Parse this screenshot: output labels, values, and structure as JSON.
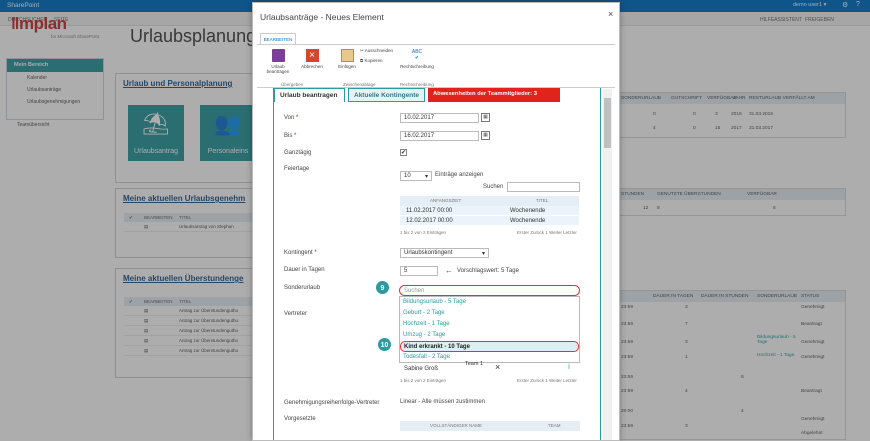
{
  "top": {
    "app": "SharePoint",
    "user": "demo user1 ▾"
  },
  "userbar": {
    "l1": "DURCHSUCHEN",
    "l2": "SEITE",
    "help": "HILFEASSISTENT",
    "share": "FREIGEBEN"
  },
  "logo": {
    "line1": "mplan",
    "line2": "for Microsoft SharePoint"
  },
  "page": {
    "title": "Urlaubsplanung H"
  },
  "nav": {
    "header": "Mein Bereich",
    "items": [
      "Kalender",
      "Urlaubsanträge",
      "Urlaubsgenehmigungen"
    ],
    "extra": "Teamübersicht"
  },
  "bg": {
    "card1": "Urlaub und Personalplanung",
    "tile1": "Urlaubsantrag",
    "tile2": "Personaleins",
    "card2": "Meine aktuellen Urlaubsgenehm",
    "card3": "Meine aktuellen Überstundenge",
    "grid_hdr": [
      "BEARBEITEN",
      "TITEL"
    ],
    "grid2_rows": [
      "Urlaubsantrag von Stephan"
    ],
    "grid3_rows": [
      "Antrag zur Überstundenguthu",
      "Antrag zur Überstundenguthu",
      "Antrag zur Überstundenguthu",
      "Antrag zur Überstundenguthu",
      "Antrag zur Überstundenguthu"
    ],
    "rt1_hdr": [
      "SONDERURLAUB",
      "GUTSCHRIFT",
      "VERFÜGBAR",
      "JAHR",
      "RESTURLAUB VERFÄLLT AM"
    ],
    "rt1_rows": [
      [
        "0",
        "0",
        "3",
        "2016",
        "31.03.2016"
      ],
      [
        "4",
        "0",
        "15",
        "2017",
        "31.03.2017"
      ]
    ],
    "rt2_hdr": [
      "STUNDEN",
      "GENUTZTE ÜBERSTUNDEN",
      "VERFÜGBAR"
    ],
    "rt2_row": [
      "12",
      "8",
      "6"
    ],
    "rt3_hdr": [
      "DAUER IN TAGEN",
      "DAUER IN STUNDEN",
      "SONDERURLAUB",
      "STATUS"
    ],
    "rt3_rows": [
      [
        "23:59",
        "3",
        "",
        "",
        "Genehmigt"
      ],
      [
        "23:59",
        "7",
        "",
        "",
        "Beantragt"
      ],
      [
        "23:59",
        "3",
        "",
        "Bildungsurlaub - 5 Tage",
        "Genehmigt"
      ],
      [
        "23:59",
        "1",
        "",
        "Hochzeit - 1 Tage",
        "Genehmigt"
      ],
      [
        "23:59",
        "",
        "8",
        "",
        ""
      ],
      [
        "23:59",
        "4",
        "",
        "",
        "Beantragt"
      ],
      [
        "20:00",
        "",
        "4",
        "",
        "Genehmigt"
      ],
      [
        "23:59",
        "3",
        "",
        "",
        "Abgelehnt"
      ]
    ]
  },
  "dialog": {
    "title": "Urlaubsanträge - Neues Element",
    "close": "×",
    "ribbon_tab": "BEARBEITEN",
    "ribbon": {
      "save": "Urlaub beantragen",
      "cancel": "Abbrechen",
      "paste": "Einfügen",
      "cut": "Ausschneiden",
      "copy": "Kopieren",
      "spell": "Rechtschreibung",
      "g1": "Übergeben",
      "g2": "Zwischenablage",
      "g3": "Rechtschreibung"
    },
    "tabs": [
      "Urlaub beantragen",
      "Aktuelle Kontingente",
      "Abwesenheiten der Teammitglieder: 3"
    ],
    "von_label": "Von",
    "von": "10.02.2017",
    "bis_label": "Bis",
    "bis": "16.02.2017",
    "ganz_label": "Ganztägig",
    "checkmark": "✔",
    "feier_label": "Feiertage",
    "entries": "10",
    "entries_text": "Einträge anzeigen",
    "search_label": "Suchen",
    "hd_cols": [
      "ANFANGSZEIT",
      "TITEL"
    ],
    "hd_rows": [
      [
        "11.02.2017 00:00",
        "Wochenende"
      ],
      [
        "12.02.2017 00:00",
        "Wochenende"
      ]
    ],
    "hd_info": "1 bis 2 von 2 Einträgen",
    "pager": "Erster  Zurück  1  Weiter  Letzter",
    "kont_label": "Kontingent",
    "kont": "Urlaubskontingent",
    "dauer_label": "Dauer in Tagen",
    "dauer": "5",
    "vorschlag": "Vorschlagswert: 5 Tage",
    "sonder_label": "Sonderurlaub",
    "sonder_ph": "Suchen",
    "options": [
      "Bildungsurlaub - 5 Tage",
      "Geburt - 2 Tage",
      "Hochzeit - 1 Tage",
      "Umzug - 2 Tage",
      "Kind erkrankt - 10 Tage",
      "Todesfall - 2 Tage"
    ],
    "badge1": "9",
    "badge2": "10",
    "vert_label": "Vertreter",
    "vert_name": "Sabine Groß",
    "vert_team": "Team 1",
    "vert_info": "1 bis 2 von 2 Einträgen",
    "gen_label": "Genehmigungsreihenfolge-Vertreter",
    "gen": "Linear - Alle müssen zustimmen",
    "vorg_label": "Vorgesetzte",
    "vg_cols": [
      "VOLLSTÄNDIGER NAME",
      "TEAM"
    ]
  }
}
